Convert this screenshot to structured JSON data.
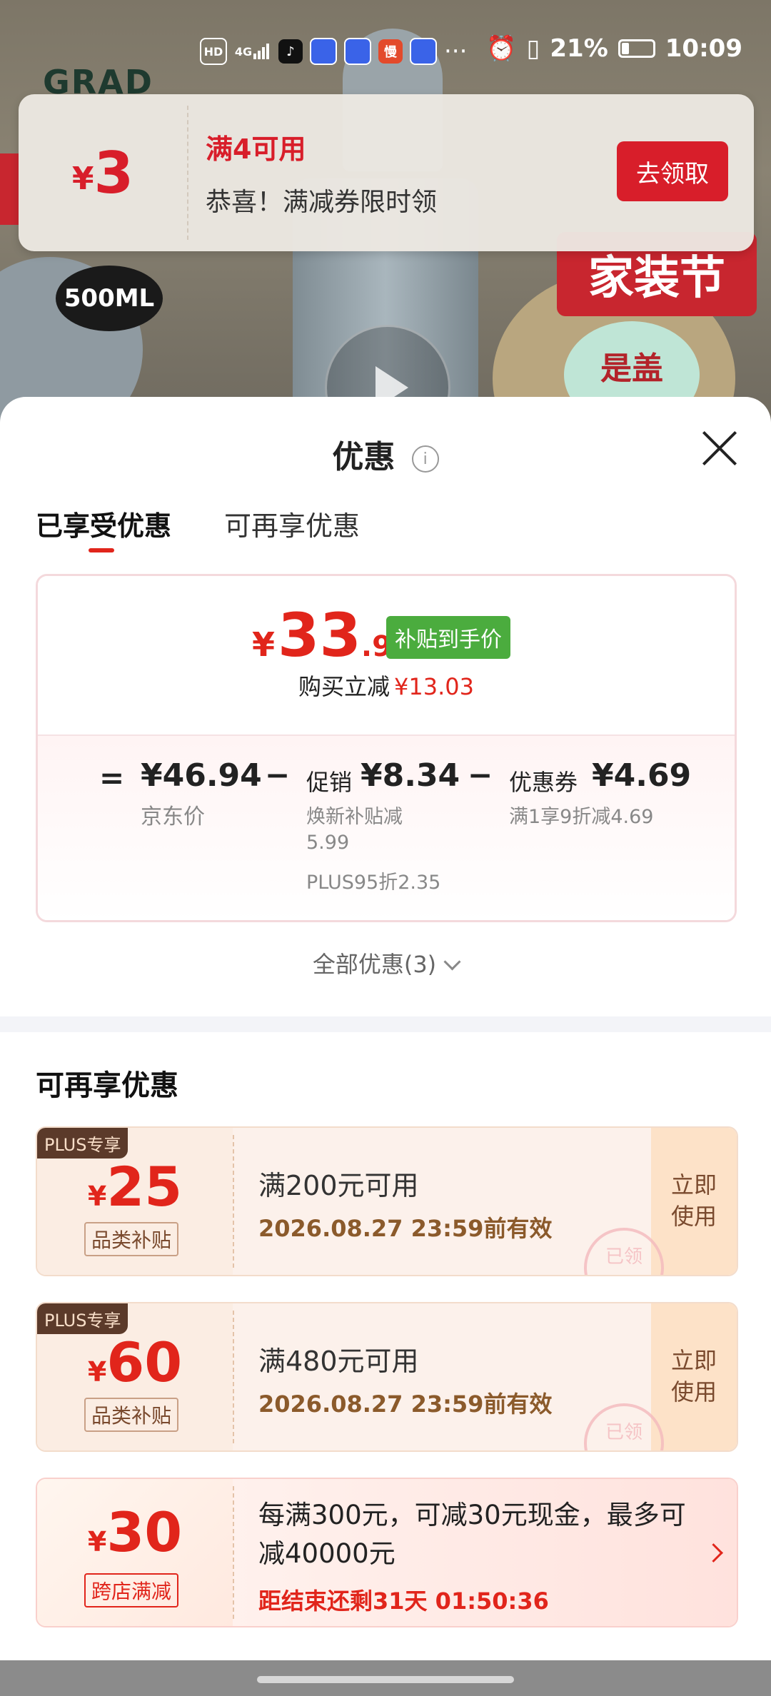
{
  "status_bar": {
    "left_icons": [
      "hd-icon",
      "signal-4g-icon",
      "tiktok-icon",
      "app-icon",
      "app-icon",
      "app-icon-red",
      "app-icon",
      "more-dots-icon"
    ],
    "hd": "HD",
    "net": "4G",
    "app_red": "慢",
    "more": "···",
    "battery": "21%",
    "time": "10:09"
  },
  "background": {
    "badge": "500ML",
    "banner": "家装节",
    "sticker": "是盖"
  },
  "toast": {
    "currency": "¥",
    "amount": "3",
    "condition": "满4可用",
    "message": "恭喜！满减券限时领",
    "button": "去领取"
  },
  "sheet": {
    "title": "优惠",
    "info_glyph": "i",
    "tabs": [
      {
        "label": "已享受优惠",
        "active": true
      },
      {
        "label": "可再享优惠",
        "active": false
      }
    ],
    "summary": {
      "currency": "¥",
      "price_int": "33",
      "price_dec": ".91",
      "subsidy_badge": "补贴到手价",
      "reduce_label": "购买立减",
      "reduce_value": "¥13.03",
      "eq": "=",
      "minus": "−",
      "jd_price": "¥46.94",
      "jd_label": "京东价",
      "promo_label": "促销",
      "promo_value": "¥8.34",
      "promo_sub1": "焕新补贴减",
      "promo_sub2": "5.99",
      "promo_sub3": "PLUS95折2.35",
      "coupon_label": "优惠券",
      "coupon_value": "¥4.69",
      "coupon_sub": "满1享9折减4.69"
    },
    "all_promos": "全部优惠(3)",
    "section_title": "可再享优惠",
    "coupons": [
      {
        "tag": "PLUS专享",
        "currency": "¥",
        "amount": "25",
        "category": "品类补贴",
        "condition": "满200元可用",
        "expiry": "2026.08.27 23:59前有效",
        "action_line1": "立即",
        "action_line2": "使用",
        "stamp": "已领"
      },
      {
        "tag": "PLUS专享",
        "currency": "¥",
        "amount": "60",
        "category": "品类补贴",
        "condition": "满480元可用",
        "expiry": "2026.08.27 23:59前有效",
        "action_line1": "立即",
        "action_line2": "使用",
        "stamp": "已领"
      },
      {
        "currency": "¥",
        "amount": "30",
        "category": "跨店满减",
        "description": "每满300元，可减30元现金，最多可减40000元",
        "timer": "距结束还剩31天 01:50:36"
      }
    ]
  },
  "colors": {
    "accent_red": "#e1251b",
    "subsidy_green": "#4bac3e",
    "coupon_brown": "#8b5a2b"
  }
}
